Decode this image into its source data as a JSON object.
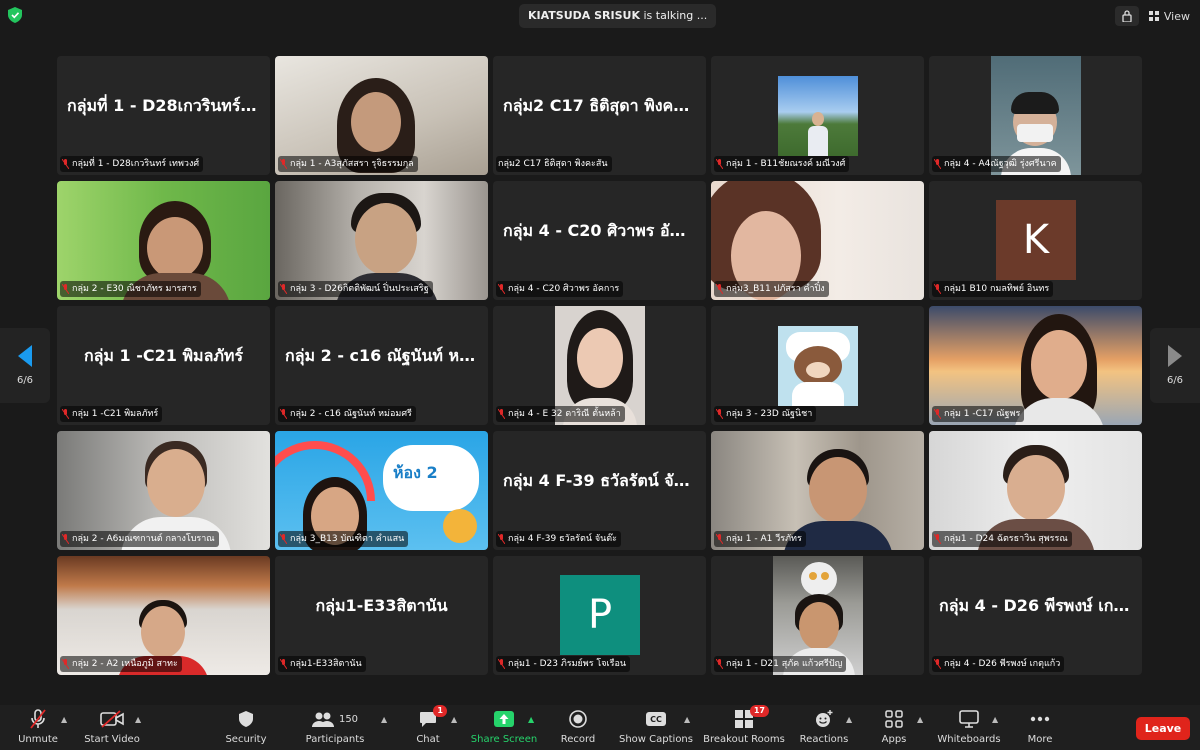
{
  "topbar": {
    "talking_name": "KIATSUDA SRISUK",
    "talking_suffix": "is talking ...",
    "view_label": "View"
  },
  "pages": {
    "left_label": "6/6",
    "right_label": "6/6"
  },
  "tiles": [
    {
      "name": "กลุ่มที่ 1 - D28เกวรินทร์ เทพวงศ์",
      "big": "กลุ่มที่ 1 - D28เกวรินทร์ เ...",
      "kind": "text"
    },
    {
      "name": "กลุ่ม 1 - A3สุภัสสรา รุจิธรรมกุล",
      "kind": "video"
    },
    {
      "name": "กลุ่ม2 C17 ธิติสุดา พิงคะสัน",
      "big": "กลุ่ม2 C17 ธิติสุดา พิงคะสัน",
      "kind": "text"
    },
    {
      "name": "กลุ่ม 1 - B11ชัยณรงค์ มณีวงศ์",
      "kind": "photo"
    },
    {
      "name": "กลุ่ม 4 - A4ณัฐวุฒิ รุ่งศรีนาค",
      "kind": "photo"
    },
    {
      "name": "กลุ่ม 2 - E30 ณิชาภัทร มารสาร",
      "kind": "video"
    },
    {
      "name": "กลุ่ม 3 - D26กิตติพัฒน์ ปิ่นประเสริฐ",
      "kind": "video"
    },
    {
      "name": "กลุ่ม 4 - C20 ศิวาพร อัคการ",
      "big": "กลุ่ม 4 - C20 ศิวาพร อัค...",
      "kind": "text"
    },
    {
      "name": "กลุ่ม3_B11 ปภัสรา คำปิ๋ง",
      "kind": "video"
    },
    {
      "name": "กลุ่ม1 B10 กมลทิพย์ อินทร",
      "letter": "K",
      "kind": "avatar"
    },
    {
      "name": "กลุ่ม 1 -C21 พิมลภัทร์",
      "big": "กลุ่ม 1 -C21 พิมลภัทร์",
      "kind": "text"
    },
    {
      "name": "กลุ่ม 2 - c16 ณัฐนันท์ หม่อมศรี",
      "big": "กลุ่ม 2 - c16 ณัฐนันท์ หม่...",
      "kind": "text"
    },
    {
      "name": "กลุ่ม 4 - E 32 ดาริณี ตั้นหล้า",
      "kind": "photo"
    },
    {
      "name": "กลุ่ม 3 - 23D ณัฐนิชา",
      "kind": "photo"
    },
    {
      "name": "กลุ่ม 1 -C17 ณัฐพร",
      "kind": "video"
    },
    {
      "name": "กลุ่ม 2 - A6มณฑกานต์ กลางโบราณ",
      "kind": "video"
    },
    {
      "name": "กลุ่ม 3_B13 บัณฑิตา คำแสน",
      "banner": "ห้อง 2",
      "kind": "video"
    },
    {
      "name": "กลุ่ม 4 F-39 ธวัลรัตน์ จันต๊ะ",
      "big": "กลุ่ม 4 F-39 ธวัลรัตน์ จันต๊ะ",
      "kind": "text"
    },
    {
      "name": "กลุ่ม 1 - A1 วีรภัทร",
      "kind": "video"
    },
    {
      "name": "กลุ่ม1 - D24 ฉัตรธาวิน สุพรรณ",
      "kind": "video"
    },
    {
      "name": "กลุ่ม 2 - A2 เหนือภูมิ สาทะ",
      "kind": "video"
    },
    {
      "name": "กลุ่ม1-E33สิตานัน",
      "big": "กลุ่ม1-E33สิตานัน",
      "kind": "text"
    },
    {
      "name": "กลุ่ม1 - D23 ภิรมย์พร โจเรือน",
      "letter": "P",
      "kind": "avatar"
    },
    {
      "name": "กลุ่ม 1 - D21 สุภัค แก้วศรีปัญ",
      "kind": "photo"
    },
    {
      "name": "กลุ่ม 4 - D26 พีรพงษ์ เกตุแก้ว",
      "big": "กลุ่ม 4 - D26 พีรพงษ์ เกตุ...",
      "kind": "text"
    }
  ],
  "toolbar": {
    "unmute": "Unmute",
    "start_video": "Start Video",
    "security": "Security",
    "participants": "Participants",
    "participants_count": "150",
    "chat": "Chat",
    "chat_badge": "1",
    "share_screen": "Share Screen",
    "record": "Record",
    "show_captions": "Show Captions",
    "breakout_rooms": "Breakout Rooms",
    "breakout_badge": "17",
    "reactions": "Reactions",
    "apps": "Apps",
    "whiteboards": "Whiteboards",
    "more": "More",
    "leave": "Leave",
    "cc_glyph": "CC"
  },
  "colors": {
    "accent_green": "#26d36b",
    "leave_red": "#e0241b",
    "arrow_blue": "#1a9bf0",
    "avatar_k": "#6b3a2a",
    "avatar_p": "#0e8f7e"
  }
}
